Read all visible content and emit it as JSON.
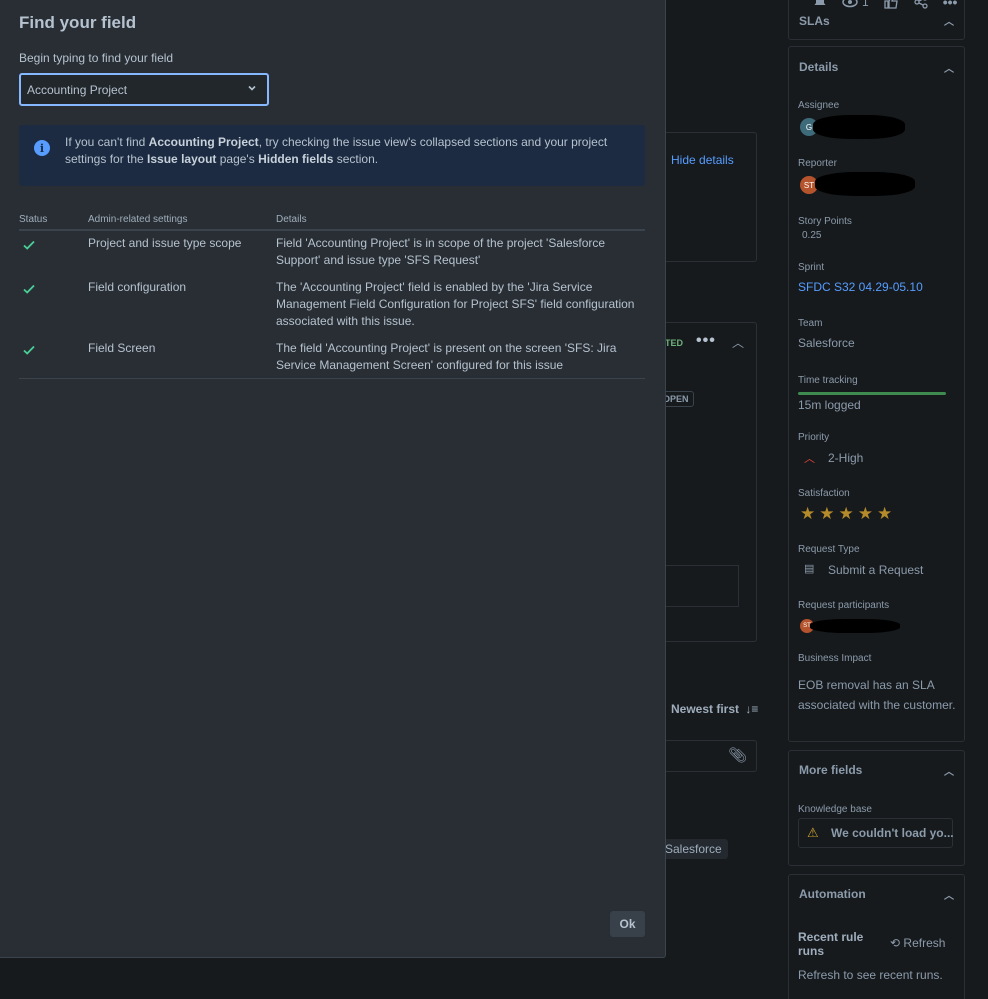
{
  "modal": {
    "title": "Find your field",
    "input_label": "Begin typing to find your field",
    "selected_field": "Accounting Project",
    "info": {
      "p1": "If you can't find ",
      "b1": "Accounting Project",
      "p2": ", try checking the issue view's collapsed sections and your project settings for the ",
      "b2": "Issue layout",
      "p3": " page's ",
      "b3": "Hidden fields",
      "p4": " section."
    },
    "table": {
      "headers": {
        "status": "Status",
        "admin": "Admin-related settings",
        "details": "Details"
      },
      "rows": [
        {
          "status": "ok",
          "admin": "Project and issue type scope",
          "details": "Field 'Accounting Project' is in scope of the project 'Salesforce Support' and issue type 'SFS Request'"
        },
        {
          "status": "ok",
          "admin": "Field configuration",
          "details": "The 'Accounting Project' field is enabled by the 'Jira Service Management Field Configuration for Project SFS' field configuration associated with this issue."
        },
        {
          "status": "ok",
          "admin": "Field Screen",
          "details": "The field 'Accounting Project' is present on the screen 'SFS: Jira Service Management Screen' configured for this issue"
        }
      ]
    },
    "ok_label": "Ok"
  },
  "background": {
    "top_bar": {
      "watch_count": "1",
      "more": "•••"
    },
    "hide_details": "Hide details",
    "status_fragment": "TED",
    "open_badge": "OPEN",
    "newest_first": "Newest first",
    "label_tag": "Salesforce",
    "sidebar": {
      "slas": "SLAs",
      "details": "Details",
      "assignee_label": "Assignee",
      "reporter_label": "Reporter",
      "reporter_initials": "ST",
      "story_points_label": "Story Points",
      "story_points": "0.25",
      "sprint_label": "Sprint",
      "sprint": "SFDC S32 04.29-05.10",
      "team_label": "Team",
      "team": "Salesforce",
      "time_tracking_label": "Time tracking",
      "time_logged": "15m logged",
      "time_tracking_fill": 1.0,
      "priority_label": "Priority",
      "priority": "2-High",
      "satisfaction_label": "Satisfaction",
      "satisfaction_stars": 5,
      "request_type_label": "Request Type",
      "request_type": "Submit a Request",
      "participants_label": "Request participants",
      "participant_initials": "ST",
      "business_impact_label": "Business Impact",
      "business_impact": "EOB removal has an SLA associated with the customer.",
      "more_fields": "More fields",
      "knowledge_base_label": "Knowledge base",
      "knowledge_base_msg": "We couldn't load yo...",
      "automation": "Automation",
      "recent_rule_runs": "Recent rule runs",
      "refresh": "Refresh",
      "refresh_hint": "Refresh to see recent runs."
    }
  },
  "colors": {
    "accent": "#579dff",
    "success_check": "#4bce97",
    "modal_bg": "#282e33",
    "info_bg": "#1c2b41",
    "focus_border": "#85b8ff"
  }
}
